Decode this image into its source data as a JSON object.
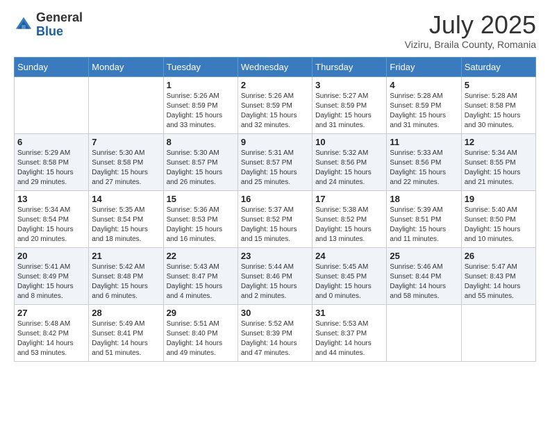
{
  "logo": {
    "general": "General",
    "blue": "Blue"
  },
  "title": "July 2025",
  "subtitle": "Viziru, Braila County, Romania",
  "weekdays": [
    "Sunday",
    "Monday",
    "Tuesday",
    "Wednesday",
    "Thursday",
    "Friday",
    "Saturday"
  ],
  "weeks": [
    [
      {
        "day": "",
        "sunrise": "",
        "sunset": "",
        "daylight": ""
      },
      {
        "day": "",
        "sunrise": "",
        "sunset": "",
        "daylight": ""
      },
      {
        "day": "1",
        "sunrise": "Sunrise: 5:26 AM",
        "sunset": "Sunset: 8:59 PM",
        "daylight": "Daylight: 15 hours and 33 minutes."
      },
      {
        "day": "2",
        "sunrise": "Sunrise: 5:26 AM",
        "sunset": "Sunset: 8:59 PM",
        "daylight": "Daylight: 15 hours and 32 minutes."
      },
      {
        "day": "3",
        "sunrise": "Sunrise: 5:27 AM",
        "sunset": "Sunset: 8:59 PM",
        "daylight": "Daylight: 15 hours and 31 minutes."
      },
      {
        "day": "4",
        "sunrise": "Sunrise: 5:28 AM",
        "sunset": "Sunset: 8:59 PM",
        "daylight": "Daylight: 15 hours and 31 minutes."
      },
      {
        "day": "5",
        "sunrise": "Sunrise: 5:28 AM",
        "sunset": "Sunset: 8:58 PM",
        "daylight": "Daylight: 15 hours and 30 minutes."
      }
    ],
    [
      {
        "day": "6",
        "sunrise": "Sunrise: 5:29 AM",
        "sunset": "Sunset: 8:58 PM",
        "daylight": "Daylight: 15 hours and 29 minutes."
      },
      {
        "day": "7",
        "sunrise": "Sunrise: 5:30 AM",
        "sunset": "Sunset: 8:58 PM",
        "daylight": "Daylight: 15 hours and 27 minutes."
      },
      {
        "day": "8",
        "sunrise": "Sunrise: 5:30 AM",
        "sunset": "Sunset: 8:57 PM",
        "daylight": "Daylight: 15 hours and 26 minutes."
      },
      {
        "day": "9",
        "sunrise": "Sunrise: 5:31 AM",
        "sunset": "Sunset: 8:57 PM",
        "daylight": "Daylight: 15 hours and 25 minutes."
      },
      {
        "day": "10",
        "sunrise": "Sunrise: 5:32 AM",
        "sunset": "Sunset: 8:56 PM",
        "daylight": "Daylight: 15 hours and 24 minutes."
      },
      {
        "day": "11",
        "sunrise": "Sunrise: 5:33 AM",
        "sunset": "Sunset: 8:56 PM",
        "daylight": "Daylight: 15 hours and 22 minutes."
      },
      {
        "day": "12",
        "sunrise": "Sunrise: 5:34 AM",
        "sunset": "Sunset: 8:55 PM",
        "daylight": "Daylight: 15 hours and 21 minutes."
      }
    ],
    [
      {
        "day": "13",
        "sunrise": "Sunrise: 5:34 AM",
        "sunset": "Sunset: 8:54 PM",
        "daylight": "Daylight: 15 hours and 20 minutes."
      },
      {
        "day": "14",
        "sunrise": "Sunrise: 5:35 AM",
        "sunset": "Sunset: 8:54 PM",
        "daylight": "Daylight: 15 hours and 18 minutes."
      },
      {
        "day": "15",
        "sunrise": "Sunrise: 5:36 AM",
        "sunset": "Sunset: 8:53 PM",
        "daylight": "Daylight: 15 hours and 16 minutes."
      },
      {
        "day": "16",
        "sunrise": "Sunrise: 5:37 AM",
        "sunset": "Sunset: 8:52 PM",
        "daylight": "Daylight: 15 hours and 15 minutes."
      },
      {
        "day": "17",
        "sunrise": "Sunrise: 5:38 AM",
        "sunset": "Sunset: 8:52 PM",
        "daylight": "Daylight: 15 hours and 13 minutes."
      },
      {
        "day": "18",
        "sunrise": "Sunrise: 5:39 AM",
        "sunset": "Sunset: 8:51 PM",
        "daylight": "Daylight: 15 hours and 11 minutes."
      },
      {
        "day": "19",
        "sunrise": "Sunrise: 5:40 AM",
        "sunset": "Sunset: 8:50 PM",
        "daylight": "Daylight: 15 hours and 10 minutes."
      }
    ],
    [
      {
        "day": "20",
        "sunrise": "Sunrise: 5:41 AM",
        "sunset": "Sunset: 8:49 PM",
        "daylight": "Daylight: 15 hours and 8 minutes."
      },
      {
        "day": "21",
        "sunrise": "Sunrise: 5:42 AM",
        "sunset": "Sunset: 8:48 PM",
        "daylight": "Daylight: 15 hours and 6 minutes."
      },
      {
        "day": "22",
        "sunrise": "Sunrise: 5:43 AM",
        "sunset": "Sunset: 8:47 PM",
        "daylight": "Daylight: 15 hours and 4 minutes."
      },
      {
        "day": "23",
        "sunrise": "Sunrise: 5:44 AM",
        "sunset": "Sunset: 8:46 PM",
        "daylight": "Daylight: 15 hours and 2 minutes."
      },
      {
        "day": "24",
        "sunrise": "Sunrise: 5:45 AM",
        "sunset": "Sunset: 8:45 PM",
        "daylight": "Daylight: 15 hours and 0 minutes."
      },
      {
        "day": "25",
        "sunrise": "Sunrise: 5:46 AM",
        "sunset": "Sunset: 8:44 PM",
        "daylight": "Daylight: 14 hours and 58 minutes."
      },
      {
        "day": "26",
        "sunrise": "Sunrise: 5:47 AM",
        "sunset": "Sunset: 8:43 PM",
        "daylight": "Daylight: 14 hours and 55 minutes."
      }
    ],
    [
      {
        "day": "27",
        "sunrise": "Sunrise: 5:48 AM",
        "sunset": "Sunset: 8:42 PM",
        "daylight": "Daylight: 14 hours and 53 minutes."
      },
      {
        "day": "28",
        "sunrise": "Sunrise: 5:49 AM",
        "sunset": "Sunset: 8:41 PM",
        "daylight": "Daylight: 14 hours and 51 minutes."
      },
      {
        "day": "29",
        "sunrise": "Sunrise: 5:51 AM",
        "sunset": "Sunset: 8:40 PM",
        "daylight": "Daylight: 14 hours and 49 minutes."
      },
      {
        "day": "30",
        "sunrise": "Sunrise: 5:52 AM",
        "sunset": "Sunset: 8:39 PM",
        "daylight": "Daylight: 14 hours and 47 minutes."
      },
      {
        "day": "31",
        "sunrise": "Sunrise: 5:53 AM",
        "sunset": "Sunset: 8:37 PM",
        "daylight": "Daylight: 14 hours and 44 minutes."
      },
      {
        "day": "",
        "sunrise": "",
        "sunset": "",
        "daylight": ""
      },
      {
        "day": "",
        "sunrise": "",
        "sunset": "",
        "daylight": ""
      }
    ]
  ]
}
